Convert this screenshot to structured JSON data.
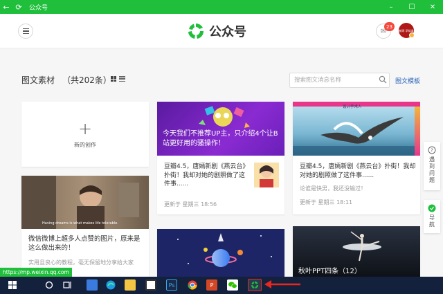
{
  "window": {
    "title": "公众号"
  },
  "header": {
    "logo_title": "公众号",
    "mail_badge": "23",
    "avatar_text": "新闻 早知道"
  },
  "section": {
    "title": "图文素材",
    "count": "（共202条）"
  },
  "search": {
    "placeholder": "搜索图文消息名称"
  },
  "template_link": "图文模板",
  "new_card": {
    "plus": "+",
    "label": "新的创作"
  },
  "articles": [
    {
      "cover_text": "今天我们不推荐UP主，只介绍4个让B站更好用的骚操作！",
      "title": "豆瓣4.5，唐嫣新剧《燕云台》扑街！我却对她的剧照做了这件事......",
      "time": "更新于 星期三 18:56"
    },
    {
      "cover_label": "设计手术人",
      "title": "豆瓣4.5，唐嫣新剧《燕云台》扑街！我却对她的剧照做了这件事......",
      "desc": "论谁是快男，我还没输过！",
      "time": "更新于 星期三 18:11"
    },
    {
      "cover_caption": "Having dreams is what makes life tolerable.",
      "title": "微信微博上超多人点赞的图片，原来是这么做出来的！",
      "desc": "实用且良心的教程，毫无保留地分享给大家"
    },
    {
      "cover_text": "秋叶PPT四条（12）"
    }
  ],
  "side_floats": [
    {
      "label": "遇到问题"
    },
    {
      "label": "导航"
    }
  ],
  "status_url": "https://mp.weixin.qq.com",
  "colors": {
    "brand": "#1fbf3c",
    "accent_red": "#e8281e",
    "link": "#2a64b8"
  }
}
